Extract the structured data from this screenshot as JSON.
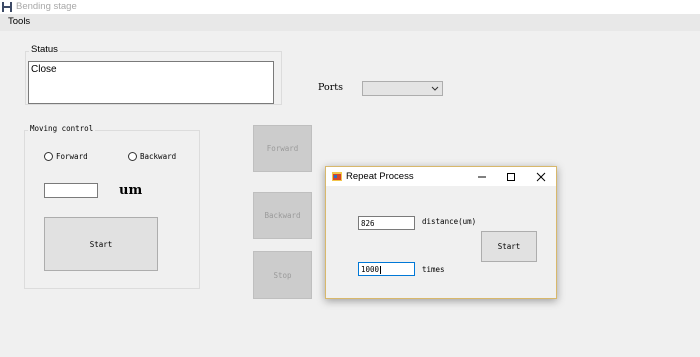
{
  "window": {
    "title": "Bending stage",
    "icon": "bending-stage-app-icon"
  },
  "menu": {
    "tools": "Tools"
  },
  "status": {
    "group_label": "Status",
    "text": "Close"
  },
  "ports": {
    "label": "Ports",
    "selected": ""
  },
  "moving_control": {
    "group_label": "Moving control",
    "radio_forward": "Forward",
    "radio_backward": "Backward",
    "position_value": "",
    "unit": "um",
    "start_button": "Start"
  },
  "side_buttons": {
    "forward": "Forward",
    "backward": "Backward",
    "stop": "Stop"
  },
  "repeat_dialog": {
    "title": "Repeat Process",
    "distance_value": "826",
    "distance_label": "distance(um)",
    "times_value": "1000",
    "times_label": "times",
    "start_button": "Start"
  },
  "colors": {
    "dialog_border": "#d8b86b",
    "focus_border": "#0078d7",
    "disabled_text": "#9a9a9a"
  }
}
